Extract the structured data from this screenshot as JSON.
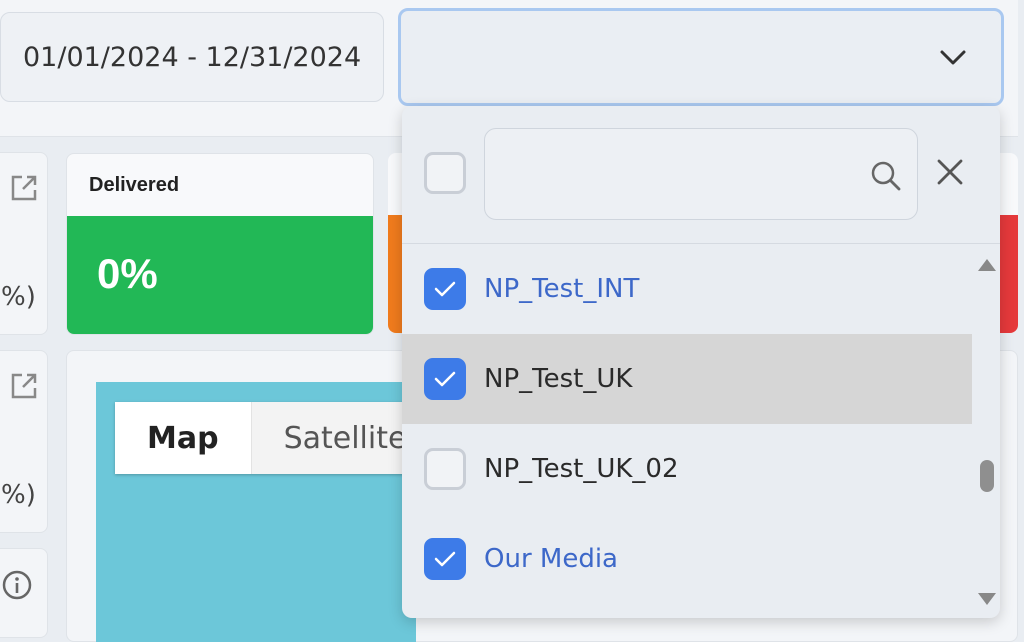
{
  "filters": {
    "date_range": "01/01/2024 - 12/31/2024",
    "select_value": ""
  },
  "side_cards": [
    {
      "pct_text": "%)"
    },
    {
      "pct_text": "%)"
    }
  ],
  "metric": {
    "title": "Delivered",
    "value": "0%"
  },
  "map": {
    "map_label": "Map",
    "satellite_label": "Satellite"
  },
  "dropdown": {
    "search_placeholder": "",
    "items": [
      {
        "label": "NP_Test_INT",
        "checked": true
      },
      {
        "label": "NP_Test_UK",
        "checked": true
      },
      {
        "label": "NP_Test_UK_02",
        "checked": false
      },
      {
        "label": "Our Media",
        "checked": true
      }
    ]
  },
  "colors": {
    "accent": "#3d7be8",
    "delivered": "#22b856",
    "orange": "#f07b1d",
    "red": "#e5393b"
  }
}
